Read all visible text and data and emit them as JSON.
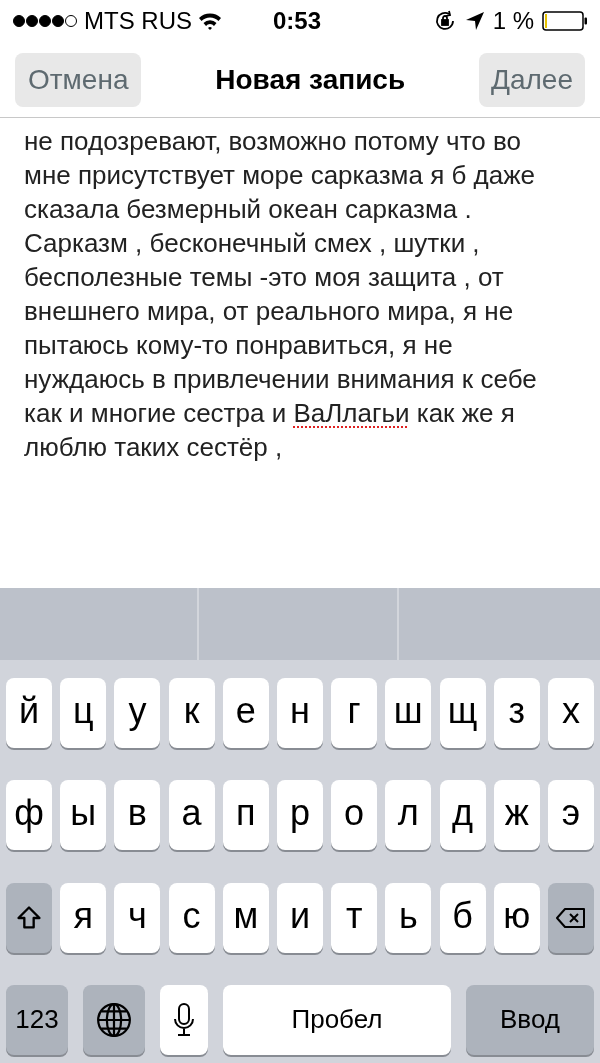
{
  "status_bar": {
    "carrier": "MTS RUS",
    "time": "0:53",
    "battery": "1 %"
  },
  "nav": {
    "cancel": "Отмена",
    "title": "Новая запись",
    "next": "Далее"
  },
  "body": [
    {
      "text": "не подозревают, возможно потому что во мне присутствует море сарказма я б даже сказала безмерный океан сарказма . Сарказм , бесконечный смех , шутки , бесполезные темы -это моя защита , от внешнего мира, от реального мира, я не пытаюсь кому-то понравиться, я не нуждаюсь в привлечении внимания к себе как и многие сестра и ",
      "misspelled": false
    },
    {
      "text": "ВаЛлагьи",
      "misspelled": true
    },
    {
      "text": " как же я люблю таких сестёр ,",
      "misspelled": false
    }
  ],
  "keyboard": {
    "rows": [
      [
        {
          "kind": "letter",
          "label": "й"
        },
        {
          "kind": "letter",
          "label": "ц"
        },
        {
          "kind": "letter",
          "label": "у"
        },
        {
          "kind": "letter",
          "label": "к"
        },
        {
          "kind": "letter",
          "label": "е"
        },
        {
          "kind": "letter",
          "label": "н"
        },
        {
          "kind": "letter",
          "label": "г"
        },
        {
          "kind": "letter",
          "label": "ш"
        },
        {
          "kind": "letter",
          "label": "щ"
        },
        {
          "kind": "letter",
          "label": "з"
        },
        {
          "kind": "letter",
          "label": "х"
        }
      ],
      [
        {
          "kind": "letter",
          "label": "ф"
        },
        {
          "kind": "letter",
          "label": "ы"
        },
        {
          "kind": "letter",
          "label": "в"
        },
        {
          "kind": "letter",
          "label": "а"
        },
        {
          "kind": "letter",
          "label": "п"
        },
        {
          "kind": "letter",
          "label": "р"
        },
        {
          "kind": "letter",
          "label": "о"
        },
        {
          "kind": "letter",
          "label": "л"
        },
        {
          "kind": "letter",
          "label": "д"
        },
        {
          "kind": "letter",
          "label": "ж"
        },
        {
          "kind": "letter",
          "label": "э"
        }
      ],
      [
        {
          "kind": "shift"
        },
        {
          "kind": "letter",
          "label": "я"
        },
        {
          "kind": "letter",
          "label": "ч"
        },
        {
          "kind": "letter",
          "label": "с"
        },
        {
          "kind": "letter",
          "label": "м"
        },
        {
          "kind": "letter",
          "label": "и"
        },
        {
          "kind": "letter",
          "label": "т"
        },
        {
          "kind": "letter",
          "label": "ь"
        },
        {
          "kind": "letter",
          "label": "б"
        },
        {
          "kind": "letter",
          "label": "ю"
        },
        {
          "kind": "backspace"
        }
      ]
    ],
    "bottom_bar": [
      {
        "kind": "numbers",
        "label": "123"
      },
      {
        "kind": "globe"
      },
      {
        "kind": "mic"
      },
      {
        "kind": "space",
        "label": "Пробел"
      },
      {
        "kind": "return",
        "label": "Ввод"
      }
    ]
  }
}
